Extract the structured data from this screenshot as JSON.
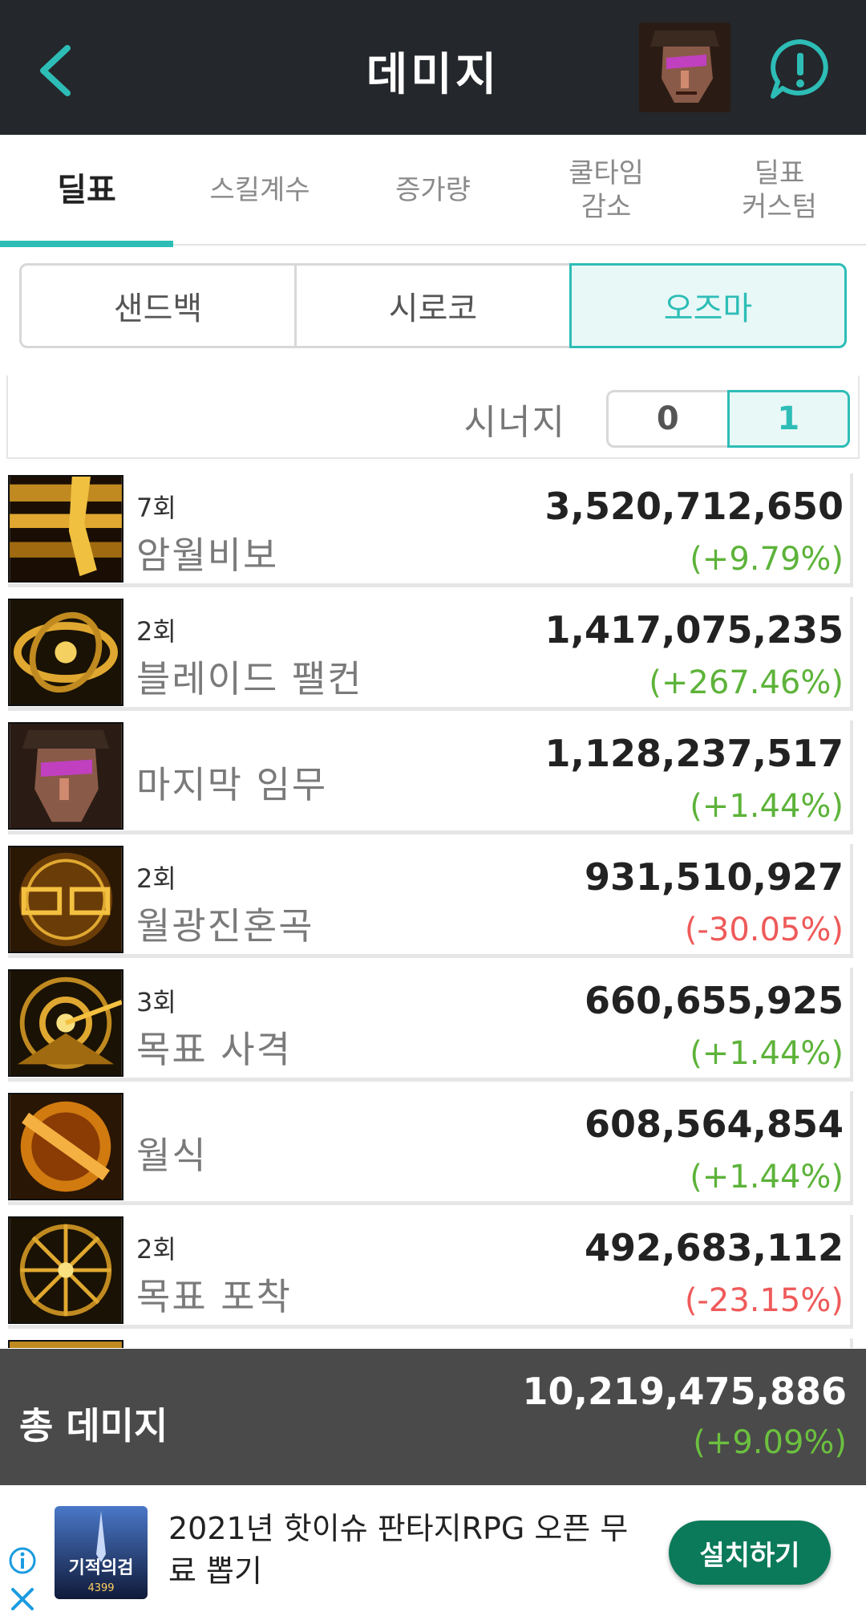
{
  "header": {
    "title": "데미지",
    "back_icon": "chevron-left-icon",
    "alert_icon": "exclamation-bubble-icon"
  },
  "tabs": [
    {
      "label": "딜표",
      "active": true
    },
    {
      "label": "스킬계수",
      "active": false
    },
    {
      "label": "증가량",
      "active": false
    },
    {
      "label": "쿨타임\n감소",
      "active": false
    },
    {
      "label": "딜표\n커스텀",
      "active": false
    }
  ],
  "bosses": [
    {
      "label": "샌드백",
      "active": false
    },
    {
      "label": "시로코",
      "active": false
    },
    {
      "label": "오즈마",
      "active": true
    }
  ],
  "synergy": {
    "label": "시너지",
    "options": [
      "0",
      "1"
    ],
    "selected": "1"
  },
  "skills": [
    {
      "count": "7회",
      "name": "암월비보",
      "damage": "3,520,712,650",
      "change": "(+9.79%)",
      "trend": "pos"
    },
    {
      "count": "2회",
      "name": "블레이드 팰컨",
      "damage": "1,417,075,235",
      "change": "(+267.46%)",
      "trend": "pos"
    },
    {
      "count": "",
      "name": "마지막 임무",
      "damage": "1,128,237,517",
      "change": "(+1.44%)",
      "trend": "pos"
    },
    {
      "count": "2회",
      "name": "월광진혼곡",
      "damage": "931,510,927",
      "change": "(-30.05%)",
      "trend": "neg"
    },
    {
      "count": "3회",
      "name": "목표 사격",
      "damage": "660,655,925",
      "change": "(+1.44%)",
      "trend": "pos"
    },
    {
      "count": "",
      "name": "월식",
      "damage": "608,564,854",
      "change": "(+1.44%)",
      "trend": "pos"
    },
    {
      "count": "2회",
      "name": "목표 포착",
      "damage": "492,683,112",
      "change": "(-23.15%)",
      "trend": "neg"
    }
  ],
  "total": {
    "label": "총 데미지",
    "value": "10,219,475,886",
    "change": "(+9.09%)"
  },
  "ad": {
    "text": "2021년 핫이슈 판타지RPG 오픈 무료 뽑기",
    "cta": "설치하기",
    "image_text": "기적의검",
    "image_sub": "4399",
    "colors": {
      "cta": "#0b7a5a"
    }
  },
  "colors": {
    "accent": "#2dbdb6",
    "positive": "#5db33a",
    "negative": "#ef5a5a",
    "header_bg": "#24272b",
    "total_bg": "#4a4a4a"
  }
}
